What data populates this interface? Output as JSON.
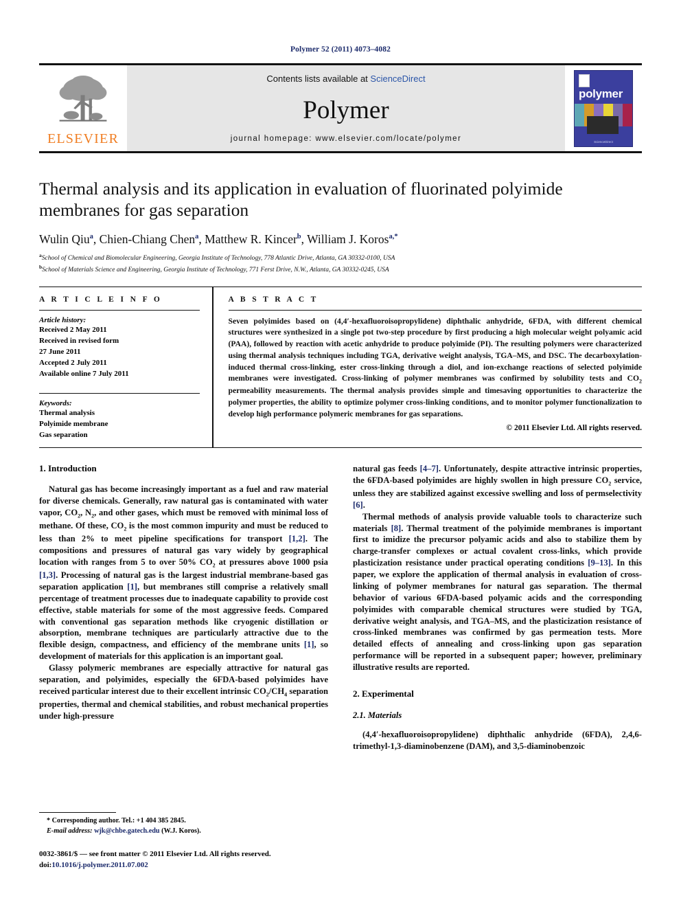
{
  "running_head": "Polymer 52 (2011) 4073–4082",
  "masthead": {
    "contents_prefix": "Contents lists available at ",
    "sciencedirect": "ScienceDirect",
    "journal_name": "Polymer",
    "homepage": "journal homepage: www.elsevier.com/locate/polymer",
    "publisher_name": "ELSEVIER",
    "cover_title": "polymer",
    "cover_footer": "Available online at\nScienceDirect",
    "logo_color": "#f07d21",
    "link_color": "#2b55a8",
    "cover_color": "#3b3f9e"
  },
  "article": {
    "title": "Thermal analysis and its application in evaluation of fluorinated polyimide membranes for gas separation",
    "authors": [
      {
        "name": "Wulin Qiu",
        "marks": "a"
      },
      {
        "name": "Chien-Chiang Chen",
        "marks": "a"
      },
      {
        "name": "Matthew R. Kincer",
        "marks": "b"
      },
      {
        "name": "William J. Koros",
        "marks": "a,*"
      }
    ],
    "affiliations": [
      {
        "mark": "a",
        "text": "School of Chemical and Biomolecular Engineering, Georgia Institute of Technology, 778 Atlantic Drive, Atlanta, GA 30332-0100, USA"
      },
      {
        "mark": "b",
        "text": "School of Materials Science and Engineering, Georgia Institute of Technology, 771 Ferst Drive, N.W., Atlanta, GA 30332-0245, USA"
      }
    ]
  },
  "article_info": {
    "heading": "A R T I C L E  I N F O",
    "history_label": "Article history:",
    "history": [
      "Received 2 May 2011",
      "Received in revised form",
      "27 June 2011",
      "Accepted 2 July 2011",
      "Available online 7 July 2011"
    ],
    "keywords_label": "Keywords:",
    "keywords": [
      "Thermal analysis",
      "Polyimide membrane",
      "Gas separation"
    ]
  },
  "abstract": {
    "heading": "A B S T R A C T",
    "text": "Seven polyimides based on (4,4′-hexafluoroisopropylidene) diphthalic anhydride, 6FDA, with different chemical structures were synthesized in a single pot two-step procedure by first producing a high molecular weight polyamic acid (PAA), followed by reaction with acetic anhydride to produce polyimide (PI). The resulting polymers were characterized using thermal analysis techniques including TGA, derivative weight analysis, TGA–MS, and DSC. The decarboxylation-induced thermal cross-linking, ester cross-linking through a diol, and ion-exchange reactions of selected polyimide membranes were investigated. Cross-linking of polymer membranes was confirmed by solubility tests and CO2 permeability measurements. The thermal analysis provides simple and timesaving opportunities to characterize the polymer properties, the ability to optimize polymer cross-linking conditions, and to monitor polymer functionalization to develop high performance polymeric membranes for gas separations.",
    "copyright": "© 2011 Elsevier Ltd. All rights reserved."
  },
  "body": {
    "section1_heading": "1. Introduction",
    "section2_heading": "2. Experimental",
    "subsection21_heading": "2.1. Materials",
    "left_paragraphs": [
      "Natural gas has become increasingly important as a fuel and raw material for diverse chemicals. Generally, raw natural gas is contaminated with water vapor, CO2, N2, and other gases, which must be removed with minimal loss of methane. Of these, CO2 is the most common impurity and must be reduced to less than 2% to meet pipeline specifications for transport [1,2]. The compositions and pressures of natural gas vary widely by geographical location with ranges from 5 to over 50% CO2 at pressures above 1000 psia [1,3]. Processing of natural gas is the largest industrial membrane-based gas separation application [1], but membranes still comprise a relatively small percentage of treatment processes due to inadequate capability to provide cost effective, stable materials for some of the most aggressive feeds. Compared with conventional gas separation methods like cryogenic distillation or absorption, membrane techniques are particularly attractive due to the flexible design, compactness, and efficiency of the membrane units [1], so development of materials for this application is an important goal.",
      "Glassy polymeric membranes are especially attractive for natural gas separation, and polyimides, especially the 6FDA-based polyimides have received particular interest due to their excellent intrinsic CO2/CH4 separation properties, thermal and chemical stabilities, and robust mechanical properties under high-pressure"
    ],
    "right_paragraphs": [
      "natural gas feeds [4–7]. Unfortunately, despite attractive intrinsic properties, the 6FDA-based polyimides are highly swollen in high pressure CO2 service, unless they are stabilized against excessive swelling and loss of permselectivity [6].",
      "Thermal methods of analysis provide valuable tools to characterize such materials [8]. Thermal treatment of the polyimide membranes is important first to imidize the precursor polyamic acids and also to stabilize them by charge-transfer complexes or actual covalent cross-links, which provide plasticization resistance under practical operating conditions [9–13]. In this paper, we explore the application of thermal analysis in evaluation of cross-linking of polymer membranes for natural gas separation. The thermal behavior of various 6FDA-based polyamic acids and the corresponding polyimides with comparable chemical structures were studied by TGA, derivative weight analysis, and TGA–MS, and the plasticization resistance of cross-linked membranes was confirmed by gas permeation tests. More detailed effects of annealing and cross-linking upon gas separation performance will be reported in a subsequent paper; however, preliminary illustrative results are reported."
    ],
    "materials_paragraph": "(4,4′-hexafluoroisopropylidene) diphthalic anhydride (6FDA), 2,4,6-trimethyl-1,3-diaminobenzene (DAM), and 3,5-diaminobenzoic"
  },
  "footnotes": {
    "corresponding": "* Corresponding author. Tel.: +1 404 385 2845.",
    "email_label": "E-mail address:",
    "email": "wjk@chbe.gatech.edu",
    "email_suffix": "(W.J. Koros).",
    "front_matter": "0032-3861/$ — see front matter © 2011 Elsevier Ltd. All rights reserved.",
    "doi_label": "doi:",
    "doi": "10.1016/j.polymer.2011.07.002"
  }
}
